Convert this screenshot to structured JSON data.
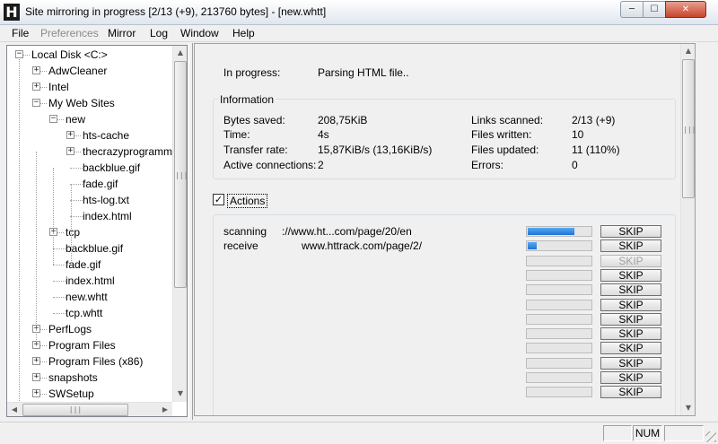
{
  "window": {
    "title": "Site mirroring in progress [2/13 (+9), 213760 bytes] - [new.whtt]",
    "icon_letter": "H",
    "controls": {
      "minimize": "─",
      "maximize": "☐",
      "close": "✕"
    }
  },
  "menu": [
    {
      "label": "File",
      "enabled": true
    },
    {
      "label": "Preferences",
      "enabled": false
    },
    {
      "label": "Mirror",
      "enabled": true
    },
    {
      "label": "Log",
      "enabled": true
    },
    {
      "label": "Window",
      "enabled": true
    },
    {
      "label": "Help",
      "enabled": true
    }
  ],
  "tree": [
    {
      "label": "Local Disk <C:>",
      "box": "−",
      "depth": 0
    },
    {
      "label": "AdwCleaner",
      "box": "+",
      "depth": 1
    },
    {
      "label": "Intel",
      "box": "+",
      "depth": 1
    },
    {
      "label": "My Web Sites",
      "box": "−",
      "depth": 1
    },
    {
      "label": "new",
      "box": "−",
      "depth": 2
    },
    {
      "label": "hts-cache",
      "box": "+",
      "depth": 3
    },
    {
      "label": "thecrazyprogrammer",
      "box": "+",
      "depth": 3
    },
    {
      "label": "backblue.gif",
      "box": "",
      "depth": 3
    },
    {
      "label": "fade.gif",
      "box": "",
      "depth": 3
    },
    {
      "label": "hts-log.txt",
      "box": "",
      "depth": 3
    },
    {
      "label": "index.html",
      "box": "",
      "depth": 3
    },
    {
      "label": "tcp",
      "box": "+",
      "depth": 2
    },
    {
      "label": "backblue.gif",
      "box": "",
      "depth": 2
    },
    {
      "label": "fade.gif",
      "box": "",
      "depth": 2
    },
    {
      "label": "index.html",
      "box": "",
      "depth": 2
    },
    {
      "label": "new.whtt",
      "box": "",
      "depth": 2
    },
    {
      "label": "tcp.whtt",
      "box": "",
      "depth": 2
    },
    {
      "label": "PerfLogs",
      "box": "+",
      "depth": 1
    },
    {
      "label": "Program Files",
      "box": "+",
      "depth": 1
    },
    {
      "label": "Program Files (x86)",
      "box": "+",
      "depth": 1
    },
    {
      "label": "snapshots",
      "box": "+",
      "depth": 1
    },
    {
      "label": "SWSetup",
      "box": "+",
      "depth": 1
    }
  ],
  "progress": {
    "label": "In progress:",
    "value": "Parsing HTML file.."
  },
  "info": {
    "title": "Information",
    "bytes_saved_label": "Bytes saved:",
    "bytes_saved": "208,75KiB",
    "time_label": "Time:",
    "time": "4s",
    "transfer_rate_label": "Transfer rate:",
    "transfer_rate": "15,87KiB/s (13,16KiB/s)",
    "active_connections_label": "Active connections:",
    "active_connections": "2",
    "links_scanned_label": "Links scanned:",
    "links_scanned": "2/13 (+9)",
    "files_written_label": "Files written:",
    "files_written": "10",
    "files_updated_label": "Files updated:",
    "files_updated": "11 (110%)",
    "errors_label": "Errors:",
    "errors": "0"
  },
  "actions": {
    "checkbox_label": "Actions",
    "checked": true,
    "rows": [
      {
        "status": "scanning",
        "url": "://www.ht...com/page/20/en",
        "progress": 0.74,
        "skip": "SKIP",
        "skip_enabled": true
      },
      {
        "status": "receive",
        "url": "www.httrack.com/page/2/",
        "progress": 0.14,
        "skip": "SKIP",
        "skip_enabled": true
      },
      {
        "status": "",
        "url": "",
        "progress": 0,
        "skip": "SKIP",
        "skip_enabled": false
      },
      {
        "status": "",
        "url": "",
        "progress": 0,
        "skip": "SKIP",
        "skip_enabled": true
      },
      {
        "status": "",
        "url": "",
        "progress": 0,
        "skip": "SKIP",
        "skip_enabled": true
      },
      {
        "status": "",
        "url": "",
        "progress": 0,
        "skip": "SKIP",
        "skip_enabled": true
      },
      {
        "status": "",
        "url": "",
        "progress": 0,
        "skip": "SKIP",
        "skip_enabled": true
      },
      {
        "status": "",
        "url": "",
        "progress": 0,
        "skip": "SKIP",
        "skip_enabled": true
      },
      {
        "status": "",
        "url": "",
        "progress": 0,
        "skip": "SKIP",
        "skip_enabled": true
      },
      {
        "status": "",
        "url": "",
        "progress": 0,
        "skip": "SKIP",
        "skip_enabled": true
      },
      {
        "status": "",
        "url": "",
        "progress": 0,
        "skip": "SKIP",
        "skip_enabled": true
      },
      {
        "status": "",
        "url": "",
        "progress": 0,
        "skip": "SKIP",
        "skip_enabled": true
      }
    ]
  },
  "statusbar": {
    "num": "NUM"
  },
  "scroll_icons": {
    "up": "▲",
    "down": "▼",
    "left": "◀",
    "right": "▶",
    "grip": "|||"
  }
}
